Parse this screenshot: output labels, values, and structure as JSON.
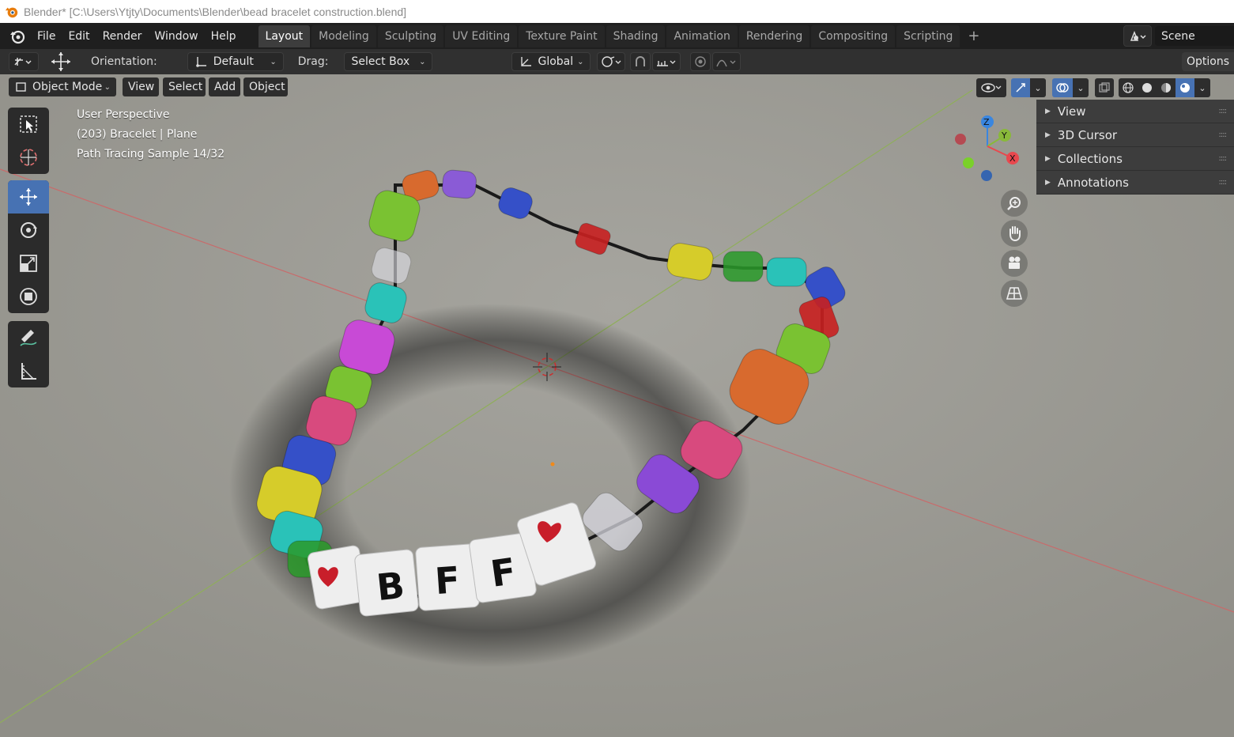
{
  "window": {
    "title": "Blender* [C:\\Users\\Ytjty\\Documents\\Blender\\bead bracelet construction.blend]"
  },
  "menu": [
    "File",
    "Edit",
    "Render",
    "Window",
    "Help"
  ],
  "workspaces": [
    "Layout",
    "Modeling",
    "Sculpting",
    "UV Editing",
    "Texture Paint",
    "Shading",
    "Animation",
    "Rendering",
    "Compositing",
    "Scripting"
  ],
  "active_workspace": "Layout",
  "scene": {
    "name": "Scene"
  },
  "toolbar": {
    "orientation_label": "Orientation:",
    "orientation_value": "Default",
    "drag_label": "Drag:",
    "drag_value": "Select Box",
    "transform_orientation": "Global",
    "options_label": "Options"
  },
  "viewport_header": {
    "mode": "Object Mode",
    "menus": [
      "View",
      "Select",
      "Add",
      "Object"
    ]
  },
  "overlay": {
    "view_name": "User Perspective",
    "object_info": "(203) Bracelet | Plane",
    "render_status": "Path Tracing Sample 14/32"
  },
  "sidebar_panels": [
    "View",
    "3D Cursor",
    "Collections",
    "Annotations"
  ],
  "gizmo": {
    "x_label": "X",
    "y_label": "Y",
    "z_label": "Z"
  },
  "scene_content": {
    "letters": [
      "B",
      "F",
      "F"
    ]
  },
  "colors": {
    "accent": "#4772b3",
    "viewport_bg": "#9b9a93",
    "axis_x": "#e8484e",
    "axis_y": "#89b93a",
    "axis_z": "#3a86e0"
  }
}
